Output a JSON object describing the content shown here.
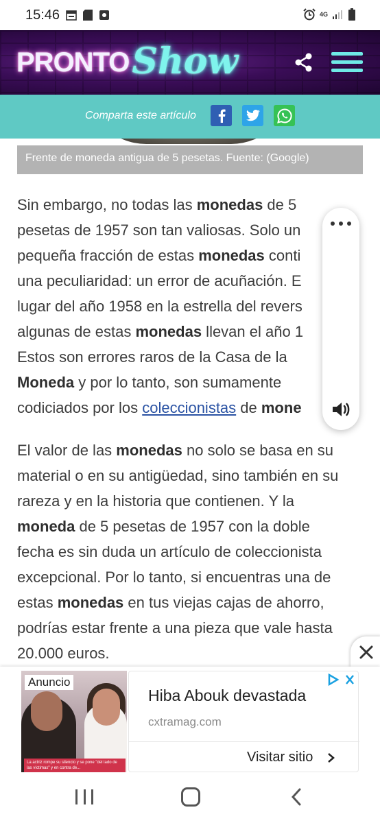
{
  "status_bar": {
    "time": "15:46",
    "network": "4G"
  },
  "header": {
    "logo_part1": "PRONTO",
    "logo_part2": "Show",
    "icons": [
      "share-icon",
      "hamburger-menu-icon"
    ],
    "colors": {
      "header_bg": "#3a0d57",
      "accent": "#6fe9e6"
    }
  },
  "share_bar": {
    "label": "Comparta este artículo",
    "buttons": [
      "facebook",
      "twitter",
      "whatsapp"
    ],
    "colors": {
      "bar_bg": "#5fc9c4",
      "facebook": "#2f5fb3",
      "twitter": "#2ea4e8",
      "whatsapp": "#36c255"
    }
  },
  "image": {
    "caption": "Frente de moneda antigua de 5 pesetas. Fuente: (Google)"
  },
  "article": {
    "p1": {
      "lines": [
        [
          "Sin embargo, no todas las ",
          {
            "b": "monedas"
          },
          " de 5"
        ],
        [
          "pesetas de 1957 son tan valiosas. Solo un"
        ],
        [
          "pequeña fracción de estas ",
          {
            "b": "monedas"
          },
          " conti"
        ],
        [
          "una peculiaridad: un error de acuñación. E"
        ],
        [
          "lugar del año 1958 en la estrella del revers"
        ],
        [
          "algunas de estas ",
          {
            "b": "monedas"
          },
          " llevan el año 1"
        ],
        [
          "Estos son errores raros de la Casa de la"
        ],
        [
          {
            "b": "Moneda"
          },
          " y por lo tanto, son sumamente"
        ],
        [
          "codiciados por los ",
          {
            "a": "coleccionistas"
          },
          " de ",
          {
            "b": "mone"
          }
        ]
      ]
    },
    "p2": {
      "lines": [
        [
          "El valor de las ",
          {
            "b": "monedas"
          },
          " no solo se basa en su"
        ],
        [
          "material o en su antigüedad, sino también en su"
        ],
        [
          "rareza y en la historia que contienen. Y la"
        ],
        [
          {
            "b": "moneda"
          },
          " de 5 pesetas de 1957 con la doble"
        ],
        [
          "fecha es sin duda un artículo de coleccionista"
        ],
        [
          "excepcional. Por lo tanto, si encuentras una de"
        ],
        [
          "estas ",
          {
            "b": "monedas"
          },
          " en tus viejas cajas de ahorro,"
        ],
        [
          "podrías estar frente a una pieza que vale hasta"
        ],
        [
          "20.000 euros."
        ]
      ]
    }
  },
  "tts_widget": {
    "icons": [
      "more-options-icon",
      "speaker-icon"
    ]
  },
  "ad": {
    "badge": "Anuncio",
    "title": "Hiba Abouk devastada",
    "domain": "cxtramag.com",
    "cta": "Visitar sitio",
    "photo_caption": "La actriz rompe su silencio y se pone \"del lado de las víctimas\" y en contra de...",
    "colors": {
      "adchoices": "#1aa1e1"
    }
  },
  "nav_bar": {
    "icons": [
      "recent-apps-icon",
      "home-icon",
      "back-icon"
    ]
  }
}
